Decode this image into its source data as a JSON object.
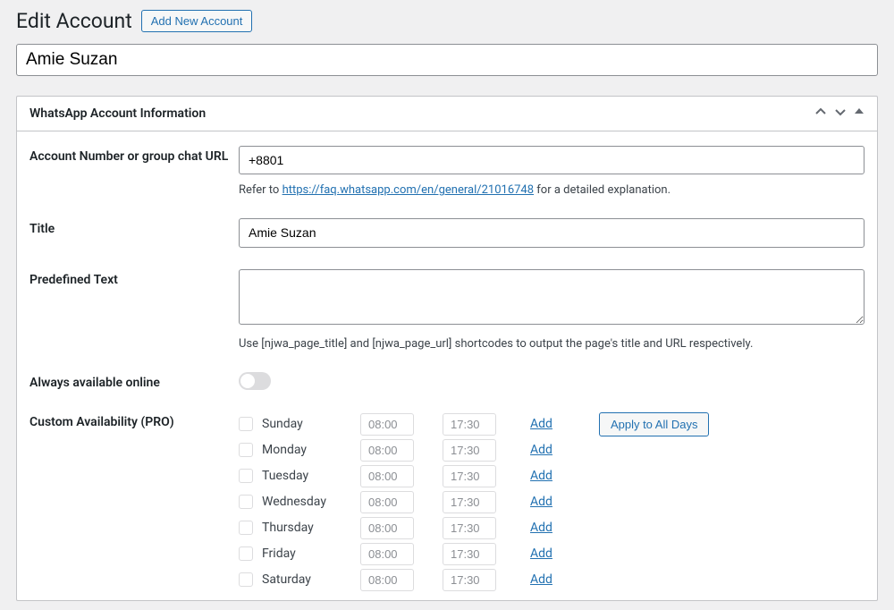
{
  "header": {
    "title": "Edit Account",
    "add_button": "Add New Account"
  },
  "account_name": "Amie Suzan",
  "panel": {
    "title": "WhatsApp Account Information",
    "fields": {
      "account_number": {
        "label": "Account Number or group chat URL",
        "value": "+8801",
        "help_prefix": "Refer to ",
        "help_link_text": "https://faq.whatsapp.com/en/general/21016748",
        "help_suffix": " for a detailed explanation."
      },
      "title_field": {
        "label": "Title",
        "value": "Amie Suzan"
      },
      "predefined_text": {
        "label": "Predefined Text",
        "value": "",
        "help": "Use [njwa_page_title] and [njwa_page_url] shortcodes to output the page's title and URL respectively."
      },
      "always_online": {
        "label": "Always available online"
      },
      "custom_availability": {
        "label": "Custom Availability (PRO)",
        "apply_all": "Apply to All Days",
        "add_label": "Add",
        "days": [
          {
            "name": "Sunday",
            "start": "08:00",
            "end": "17:30"
          },
          {
            "name": "Monday",
            "start": "08:00",
            "end": "17:30"
          },
          {
            "name": "Tuesday",
            "start": "08:00",
            "end": "17:30"
          },
          {
            "name": "Wednesday",
            "start": "08:00",
            "end": "17:30"
          },
          {
            "name": "Thursday",
            "start": "08:00",
            "end": "17:30"
          },
          {
            "name": "Friday",
            "start": "08:00",
            "end": "17:30"
          },
          {
            "name": "Saturday",
            "start": "08:00",
            "end": "17:30"
          }
        ]
      }
    }
  }
}
